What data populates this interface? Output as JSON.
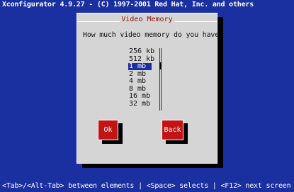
{
  "screen": {
    "title": "Xconfigurator 4.9.27 - (C) 1997-2001 Red Hat, Inc. and others"
  },
  "dialog": {
    "title": "Video Memory",
    "prompt": "How much video memory do you have?",
    "list": {
      "options": [
        "256 kb",
        "512 kb",
        "1 mb",
        "2 mb",
        "4 mb",
        "8 mb",
        "16 mb",
        "32 mb"
      ],
      "selected_index": 2,
      "scroll_position": 0.25
    },
    "buttons": {
      "ok_label": "Ok",
      "back_label": "Back"
    }
  },
  "status_bar": {
    "text": "<Tab>/<Alt-Tab> between elements  |  <Space> selects  |  <F12> next screen"
  },
  "colors": {
    "background": "#1a2fa0",
    "dialog_bg": "#d5d5d5",
    "title_text": "#8a1010",
    "button_bg": "#c31414",
    "selection_bg": "#1a2fa0"
  }
}
